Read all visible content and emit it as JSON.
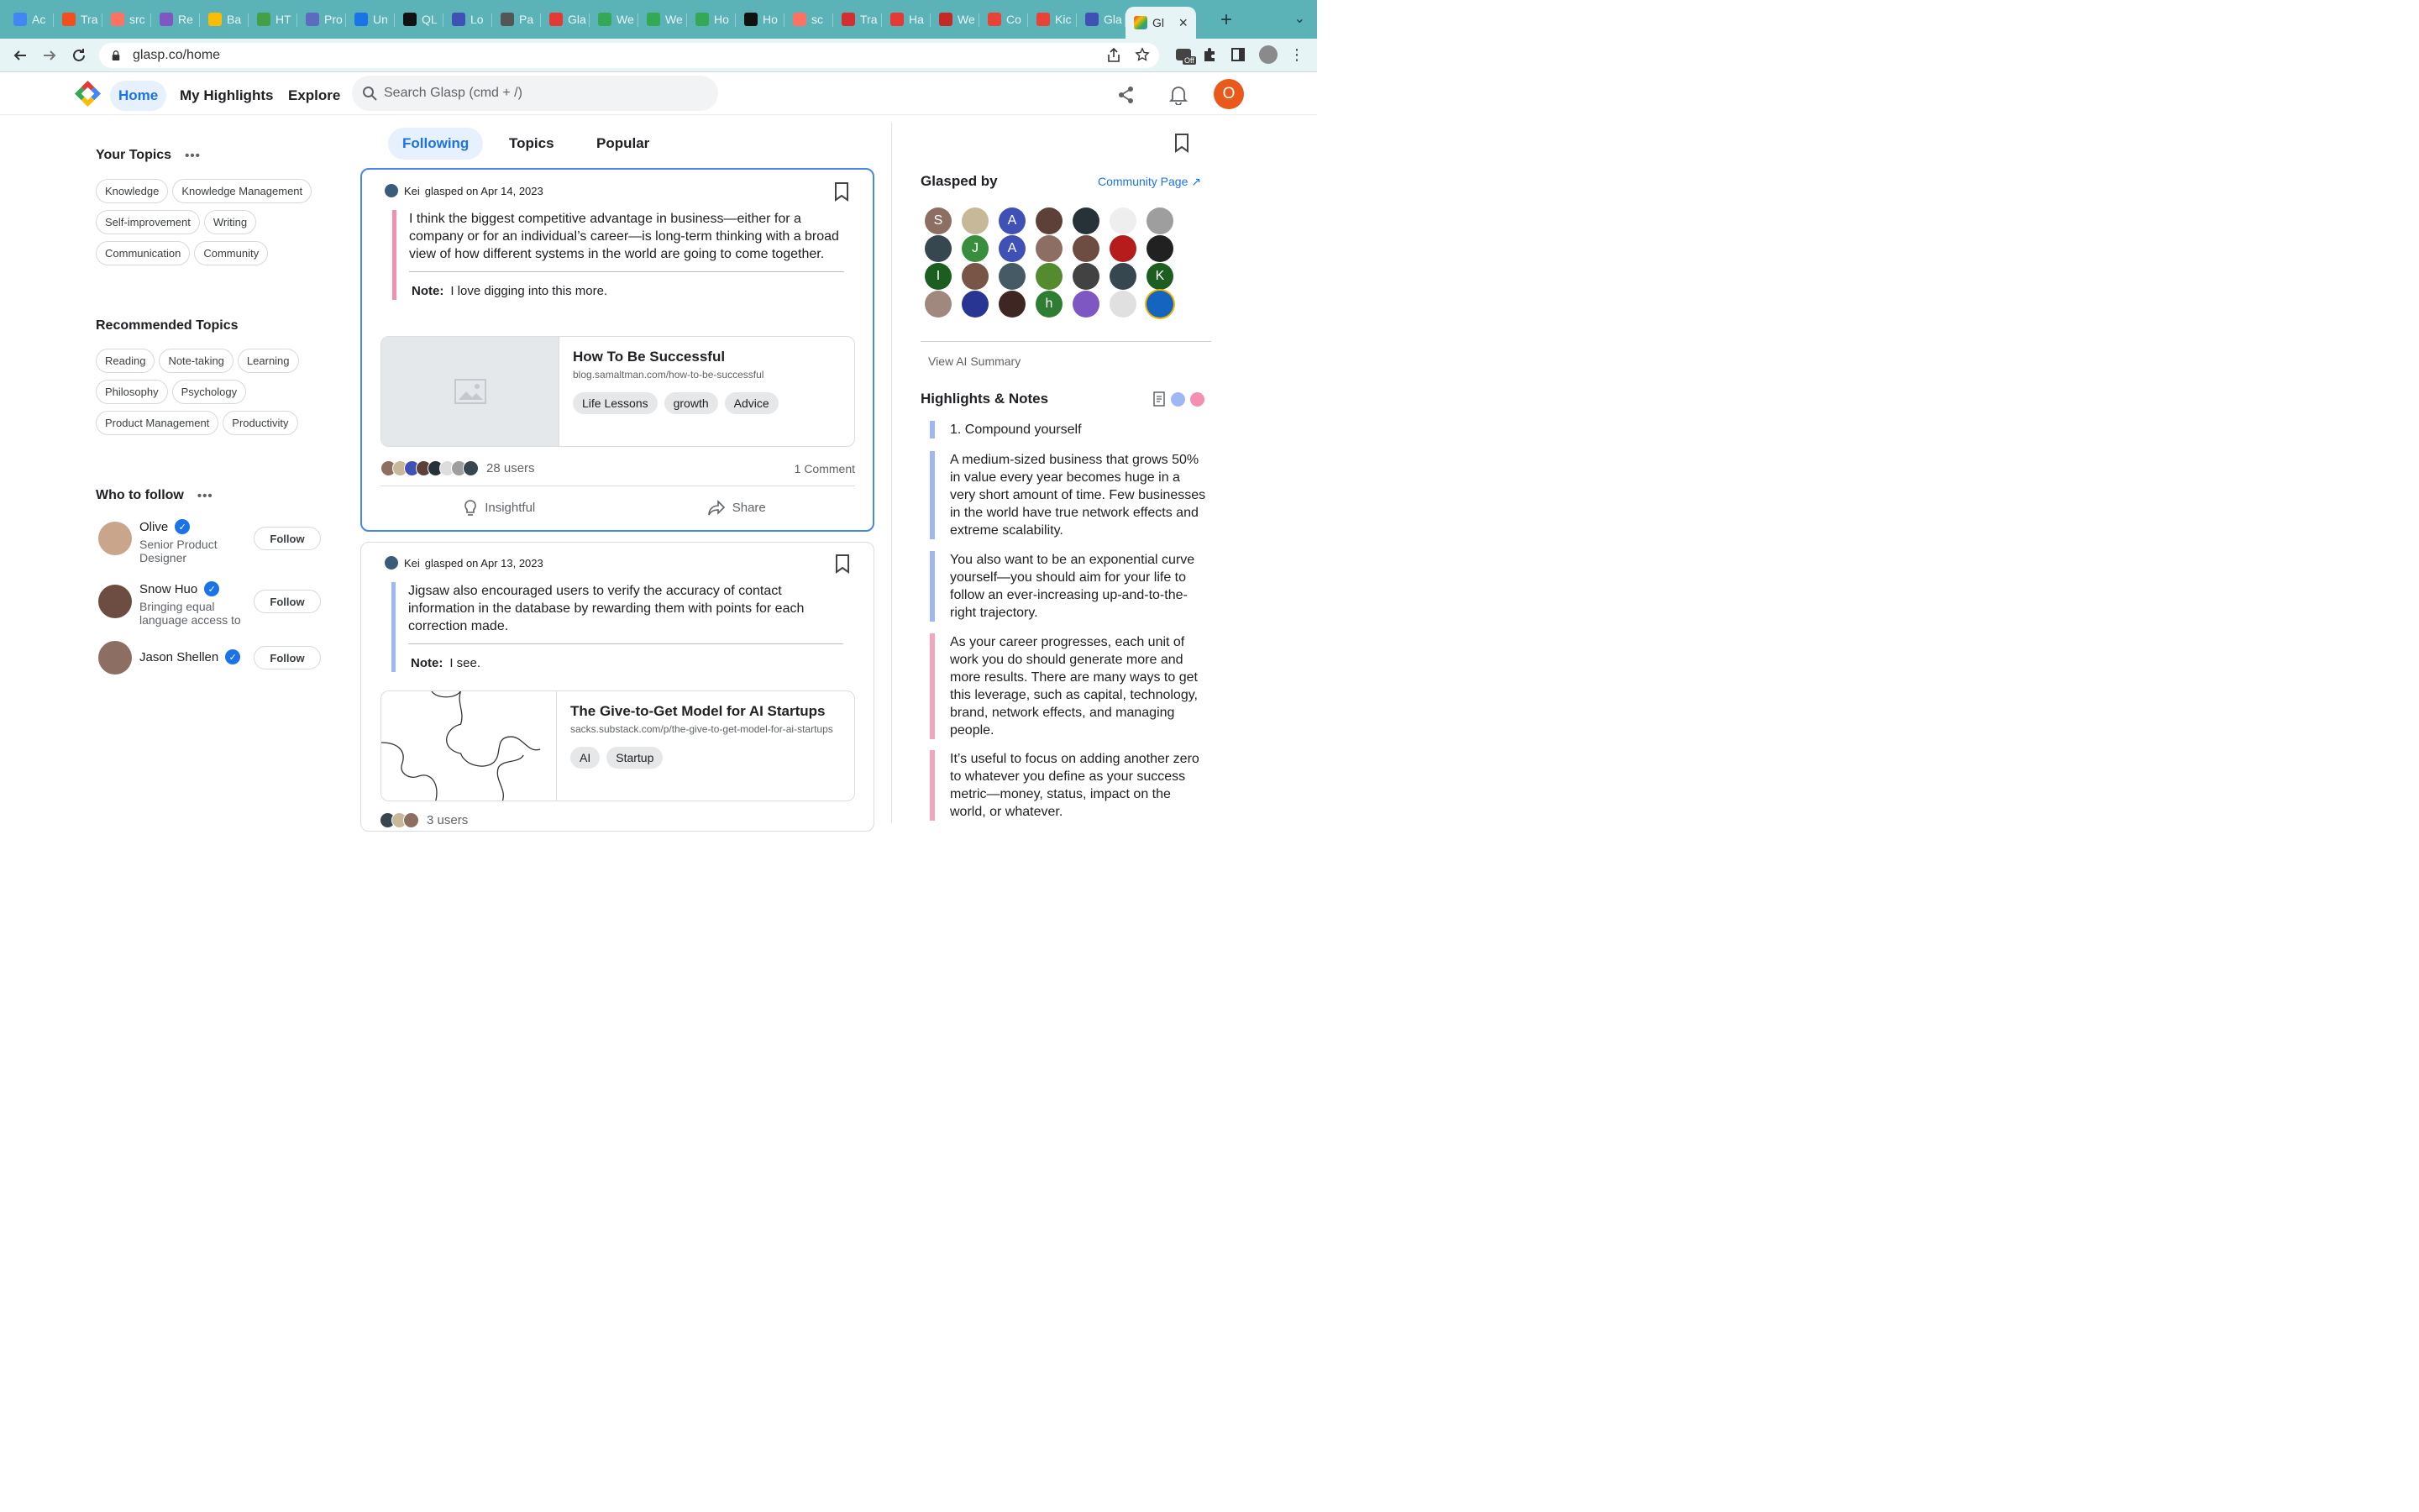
{
  "browser": {
    "tabs": [
      {
        "label": "Ac",
        "color": "#4285f4"
      },
      {
        "label": "Tra",
        "color": "#f24e1e"
      },
      {
        "label": "src",
        "color": "#ff7262"
      },
      {
        "label": "Re",
        "color": "#7e57c2"
      },
      {
        "label": "Ba",
        "color": "#fbbc04"
      },
      {
        "label": "HT",
        "color": "#43a047"
      },
      {
        "label": "Pro",
        "color": "#5c6bc0"
      },
      {
        "label": "Un",
        "color": "#1a73e8"
      },
      {
        "label": "QL",
        "color": "#111111"
      },
      {
        "label": "Lo",
        "color": "#3f51b5"
      },
      {
        "label": "Pa",
        "color": "#555555"
      },
      {
        "label": "Gla",
        "color": "#e53935"
      },
      {
        "label": "We",
        "color": "#34a853"
      },
      {
        "label": "We",
        "color": "#34a853"
      },
      {
        "label": "Ho",
        "color": "#34a853"
      },
      {
        "label": "Ho",
        "color": "#111111"
      },
      {
        "label": "sc",
        "color": "#ff7262"
      },
      {
        "label": "Tra",
        "color": "#d32f2f"
      },
      {
        "label": "Ha",
        "color": "#e53935"
      },
      {
        "label": "We",
        "color": "#c62828"
      },
      {
        "label": "Co",
        "color": "#ea4335"
      },
      {
        "label": "Kic",
        "color": "#ea4335"
      },
      {
        "label": "Gla",
        "color": "#3f51b5"
      }
    ],
    "active_tab_label": "Gl",
    "url": "glasp.co/home",
    "ext_badge": "Off"
  },
  "header": {
    "nav": [
      "Home",
      "My Highlights",
      "Explore"
    ],
    "search_placeholder": "Search Glasp (cmd + /)",
    "avatar_letter": "O"
  },
  "sidebar": {
    "your_topics_title": "Your Topics",
    "your_topics": [
      "Knowledge",
      "Knowledge Management",
      "Self-improvement",
      "Writing",
      "Communication",
      "Community"
    ],
    "recommended_title": "Recommended Topics",
    "recommended": [
      "Reading",
      "Note-taking",
      "Learning",
      "Philosophy",
      "Psychology",
      "Product Management",
      "Productivity"
    ],
    "who_to_follow_title": "Who to follow",
    "follow": [
      {
        "name": "Olive",
        "sub": "Senior Product Designer",
        "button": "Follow"
      },
      {
        "name": "Snow Huo",
        "sub": "Bringing equal language access to",
        "button": "Follow"
      },
      {
        "name": "Jason Shellen",
        "sub": "",
        "button": "Follow"
      }
    ],
    "dots": "•••"
  },
  "feed": {
    "tabs": [
      "Following",
      "Topics",
      "Popular"
    ],
    "cards": [
      {
        "user": "Kei",
        "meta": "glasped on Apr 14, 2023",
        "quote": "I think the biggest competitive advantage in business—either for a company or for an individual’s career—is long-term thinking with a broad view of how different systems in the world are going to come together.",
        "note_label": "Note:",
        "note": "I love digging into this more.",
        "title": "How To Be Successful",
        "url": "blog.samaltman.com/how-to-be-successful",
        "tags": [
          "Life Lessons",
          "growth",
          "Advice"
        ],
        "users": "28 users",
        "comments": "1 Comment",
        "insightful": "Insightful",
        "share": "Share"
      },
      {
        "user": "Kei",
        "meta": "glasped on Apr 13, 2023",
        "quote": "Jigsaw also encouraged users to verify the accuracy of contact information in the database by rewarding them with points for each correction made.",
        "note_label": "Note:",
        "note": "I see.",
        "title": "The Give-to-Get Model for AI Startups",
        "url": "sacks.substack.com/p/the-give-to-get-model-for-ai-startups",
        "tags": [
          "AI",
          "Startup"
        ],
        "users": "3 users"
      }
    ]
  },
  "right": {
    "glasped_by": "Glasped by",
    "community_page": "Community Page ↗",
    "avatars": [
      {
        "letter": "S",
        "color": "#8d6e63"
      },
      {
        "letter": "",
        "color": "#c8b89a"
      },
      {
        "letter": "A",
        "color": "#3f51b5"
      },
      {
        "letter": "",
        "color": "#5d4037"
      },
      {
        "letter": "",
        "color": "#263238"
      },
      {
        "letter": "",
        "color": "#eeeeee"
      },
      {
        "letter": "",
        "color": "#9e9e9e"
      },
      {
        "letter": "",
        "color": "#37474f"
      },
      {
        "letter": "J",
        "color": "#388e3c"
      },
      {
        "letter": "A",
        "color": "#3f51b5"
      },
      {
        "letter": "",
        "color": "#8d6e63"
      },
      {
        "letter": "",
        "color": "#6d4c41"
      },
      {
        "letter": "",
        "color": "#b71c1c"
      },
      {
        "letter": "",
        "color": "#212121"
      },
      {
        "letter": "I",
        "color": "#1b5e20"
      },
      {
        "letter": "",
        "color": "#795548"
      },
      {
        "letter": "",
        "color": "#455a64"
      },
      {
        "letter": "",
        "color": "#558b2f"
      },
      {
        "letter": "",
        "color": "#424242"
      },
      {
        "letter": "",
        "color": "#37474f"
      },
      {
        "letter": "K",
        "color": "#1b5e20"
      },
      {
        "letter": "",
        "color": "#a1887f"
      },
      {
        "letter": "",
        "color": "#283593"
      },
      {
        "letter": "",
        "color": "#3e2723"
      },
      {
        "letter": "h",
        "color": "#2e7d32"
      },
      {
        "letter": "",
        "color": "#7e57c2"
      },
      {
        "letter": "",
        "color": "#e0e0e0"
      },
      {
        "letter": "",
        "color": "#1565c0"
      }
    ],
    "view_ai_summary": "View AI Summary",
    "highlights_title": "Highlights & Notes",
    "highlights": [
      {
        "text": "1. Compound yourself",
        "color": "blue"
      },
      {
        "text": "A medium-sized business that grows 50% in value every year becomes huge in a very short amount of time. Few businesses in the world have true network effects and extreme scalability.",
        "color": "blue"
      },
      {
        "text": "You also want to be an exponential curve yourself—you should aim for your life to follow an ever-increasing up-and-to-the-right trajectory.",
        "color": "blue"
      },
      {
        "text": "As your career progresses, each unit of work you do should generate more and more results. There are many ways to get this leverage, such as capital, technology, brand, network effects, and managing people.",
        "color": "pink"
      },
      {
        "text": "It’s useful to focus on adding another zero to whatever you define as your success metric—money, status, impact on the world, or whatever.",
        "color": "pink"
      }
    ]
  }
}
